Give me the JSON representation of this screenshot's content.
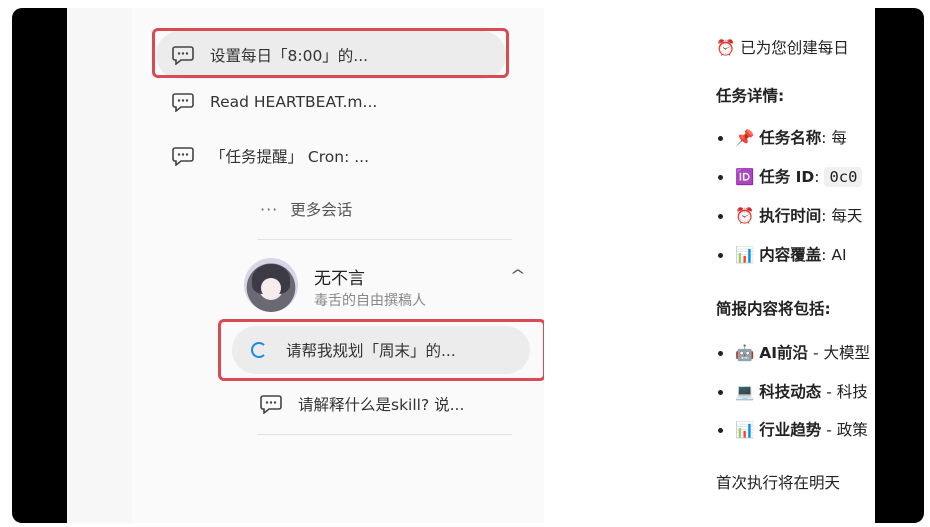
{
  "sidebar": {
    "conversations": [
      {
        "label": "设置每日「8:00」的...",
        "icon": "chat-bubble-icon"
      },
      {
        "label": "Read HEARTBEAT.m...",
        "icon": "chat-bubble-icon"
      },
      {
        "label": "「任务提醒」 Cron: ...",
        "icon": "chat-bubble-icon"
      }
    ],
    "more_icon": "···",
    "more_label": "更多会话",
    "agent": {
      "name": "无不言",
      "description": "毒舌的自由撰稿人",
      "chevron": "^"
    },
    "agent_conversations": [
      {
        "label": "请帮我规划「周末」的...",
        "icon": "loading-spinner-icon"
      },
      {
        "label": "请解释什么是skill? 说...",
        "icon": "chat-bubble-icon"
      }
    ]
  },
  "chat": {
    "intro": "已为您创建每日",
    "intro_icon": "⏰",
    "details_heading": "任务详情:",
    "details": [
      {
        "icon": "📌",
        "label": "任务名称",
        "value": "每"
      },
      {
        "icon": "🆔",
        "label": "任务 ID",
        "value": "0c0"
      },
      {
        "icon": "⏰",
        "label": "执行时间",
        "value": "每天"
      },
      {
        "icon": "📊",
        "label": "内容覆盖",
        "value": "AI"
      }
    ],
    "content_heading": "简报内容将包括:",
    "content_items": [
      {
        "icon": "🤖",
        "label": "AI前沿",
        "rest": " - 大模型"
      },
      {
        "icon": "💻",
        "label": "科技动态",
        "rest": " - 科技"
      },
      {
        "icon": "📊",
        "label": "行业趋势",
        "rest": " - 政策"
      }
    ],
    "footer": "首次执行将在明天"
  }
}
